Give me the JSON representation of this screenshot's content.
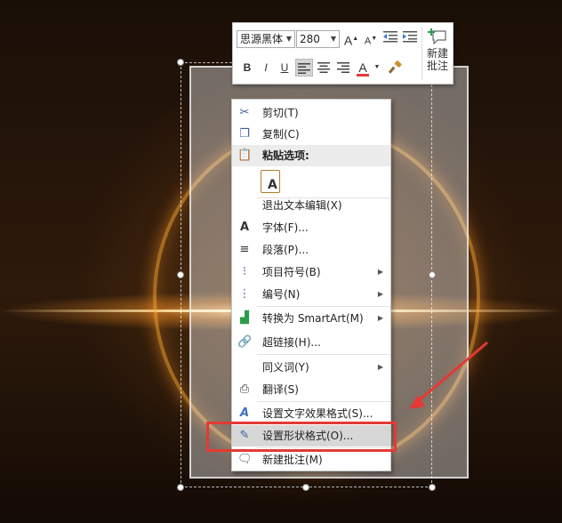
{
  "mini_toolbar": {
    "font_name": "思源黑体",
    "font_size": "280",
    "grow_font_label": "A",
    "shrink_font_label": "A",
    "bold_label": "B",
    "italic_label": "I",
    "underline_label": "U",
    "font_color_label": "A",
    "new_comment_line1": "新建",
    "new_comment_line2": "批注",
    "font_color_hex": "#e53935"
  },
  "context_menu": {
    "items": [
      {
        "label": "剪切(T)",
        "icon": "scissors-icon"
      },
      {
        "label": "复制(C)",
        "icon": "copy-icon"
      },
      {
        "label": "粘贴选项:",
        "icon": "paste-icon"
      },
      {
        "label": "退出文本编辑(X)",
        "icon": ""
      },
      {
        "label": "字体(F)...",
        "icon": "font-icon"
      },
      {
        "label": "段落(P)...",
        "icon": "paragraph-icon"
      },
      {
        "label": "项目符号(B)",
        "icon": "bullets-icon"
      },
      {
        "label": "编号(N)",
        "icon": "numbering-icon"
      },
      {
        "label": "转换为 SmartArt(M)",
        "icon": "smartart-icon"
      },
      {
        "label": "超链接(H)...",
        "icon": "hyperlink-icon"
      },
      {
        "label": "同义词(Y)",
        "icon": ""
      },
      {
        "label": "翻译(S)",
        "icon": "translate-icon"
      },
      {
        "label": "设置文字效果格式(S)...",
        "icon": "text-effect-icon"
      },
      {
        "label": "设置形状格式(O)...",
        "icon": "format-shape-icon"
      },
      {
        "label": "新建批注(M)",
        "icon": "comment-icon"
      }
    ],
    "paste_keep_text_label": "A"
  },
  "annotation": {
    "highlight_color": "#e53935"
  }
}
